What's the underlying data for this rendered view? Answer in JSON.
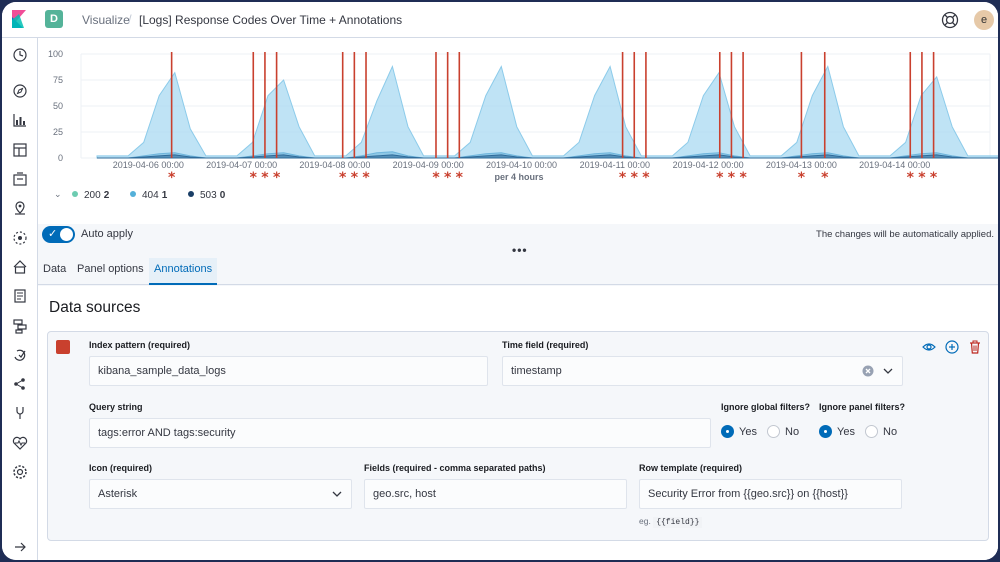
{
  "header": {
    "app_badge": "D",
    "breadcrumb_app": "Visualize",
    "breadcrumb_title": "[Logs] Response Codes Over Time + Annotations",
    "avatar_initial": "e"
  },
  "sidebar": {
    "items": [
      "recent-icon",
      "discover-icon",
      "visualize-icon",
      "dashboard-icon",
      "canvas-icon",
      "maps-icon",
      "ml-icon",
      "infrastructure-icon",
      "logs-icon",
      "apm-icon",
      "uptime-icon",
      "graph-icon",
      "devtools-icon",
      "monitoring-icon",
      "management-icon",
      "collapse-icon"
    ]
  },
  "chart_data": {
    "type": "area",
    "xlabel": "per 4 hours",
    "x_ticks": [
      "2019-04-06 00:00",
      "2019-04-07 00:00",
      "2019-04-08 00:00",
      "2019-04-09 00:00",
      "2019-04-10 00:00",
      "2019-04-11 00:00",
      "2019-04-12 00:00",
      "2019-04-13 00:00",
      "2019-04-14 00:00"
    ],
    "y_ticks": [
      0,
      25,
      50,
      75,
      100
    ],
    "ylim": [
      0,
      100
    ],
    "series": [
      {
        "name": "200",
        "color": "#6dccb1",
        "values": [
          2,
          2,
          2,
          15,
          60,
          82,
          28,
          2,
          2,
          2,
          15,
          60,
          75,
          30,
          2,
          2,
          2,
          15,
          55,
          88,
          30,
          2,
          2,
          2,
          15,
          60,
          88,
          30,
          2,
          2,
          2,
          15,
          60,
          88,
          30,
          2,
          2,
          2,
          15,
          60,
          82,
          30,
          2,
          2,
          2,
          15,
          60,
          88,
          30,
          2,
          2,
          2,
          15,
          60,
          78,
          30,
          2,
          2,
          2,
          15,
          60,
          80,
          30,
          2,
          2
        ]
      },
      {
        "name": "404",
        "color": "#54b0d9",
        "values": [
          0,
          0,
          0,
          2,
          4,
          5,
          2,
          0,
          0,
          0,
          2,
          4,
          5,
          2,
          0,
          0,
          0,
          2,
          5,
          6,
          2,
          0,
          0,
          0,
          2,
          4,
          5,
          2,
          0,
          0,
          0,
          2,
          4,
          5,
          2,
          0,
          0,
          0,
          2,
          4,
          5,
          2,
          0,
          0,
          0,
          2,
          4,
          5,
          2,
          0,
          0,
          0,
          2,
          4,
          5,
          2,
          0,
          0,
          0,
          2,
          4,
          5,
          2,
          0,
          0
        ]
      },
      {
        "name": "503",
        "color": "#1a3e66",
        "values": [
          0,
          0,
          0,
          1,
          2,
          3,
          1,
          0,
          0,
          0,
          1,
          2,
          3,
          1,
          0,
          0,
          0,
          1,
          2,
          3,
          1,
          0,
          0,
          0,
          1,
          2,
          3,
          1,
          0,
          0,
          0,
          1,
          2,
          3,
          1,
          0,
          0,
          0,
          1,
          2,
          3,
          1,
          0,
          0,
          0,
          1,
          2,
          3,
          1,
          0,
          0,
          0,
          1,
          2,
          3,
          1,
          0,
          0,
          0,
          1,
          2,
          3,
          1,
          0,
          0
        ]
      }
    ],
    "annotation_marker": "*",
    "annotation_times": [
      "2019-04-06 06:00",
      "2019-04-07 03:00",
      "2019-04-07 06:00",
      "2019-04-07 09:00",
      "2019-04-08 02:00",
      "2019-04-08 05:00",
      "2019-04-08 08:00",
      "2019-04-09 02:00",
      "2019-04-09 05:00",
      "2019-04-09 08:00",
      "2019-04-11 02:00",
      "2019-04-11 05:00",
      "2019-04-11 08:00",
      "2019-04-12 03:00",
      "2019-04-12 06:00",
      "2019-04-12 09:00",
      "2019-04-13 00:00",
      "2019-04-13 06:00",
      "2019-04-14 04:00",
      "2019-04-14 07:00",
      "2019-04-14 10:00"
    ],
    "annotation_color": "#c9402e"
  },
  "legend": {
    "items": [
      {
        "label": "200",
        "value": "2",
        "color": "#6dccb1"
      },
      {
        "label": "404",
        "value": "1",
        "color": "#54b0d9"
      },
      {
        "label": "503",
        "value": "0",
        "color": "#1a3e66"
      }
    ]
  },
  "editor": {
    "auto_apply_label": "Auto apply",
    "auto_apply_note": "The changes will be automatically applied.",
    "more_label": "•••",
    "tabs": [
      "Data",
      "Panel options",
      "Annotations"
    ],
    "active_tab": "Annotations",
    "section_title": "Data sources",
    "annotation_color": "#c9402e",
    "index_pattern_label": "Index pattern (required)",
    "index_pattern_value": "kibana_sample_data_logs",
    "time_field_label": "Time field (required)",
    "time_field_value": "timestamp",
    "query_label": "Query string",
    "query_value": "tags:error AND tags:security",
    "ignore_global_label": "Ignore global filters?",
    "ignore_panel_label": "Ignore panel filters?",
    "yes_label": "Yes",
    "no_label": "No",
    "ignore_global": "Yes",
    "ignore_panel": "Yes",
    "icon_label": "Icon (required)",
    "icon_value": "Asterisk",
    "fields_label": "Fields (required - comma separated paths)",
    "fields_value": "geo.src, host",
    "row_template_label": "Row template (required)",
    "row_template_value": "Security Error from {{geo.src}} on {{host}}",
    "row_template_hint": "eg.",
    "row_template_hint_code": "{{field}}"
  }
}
